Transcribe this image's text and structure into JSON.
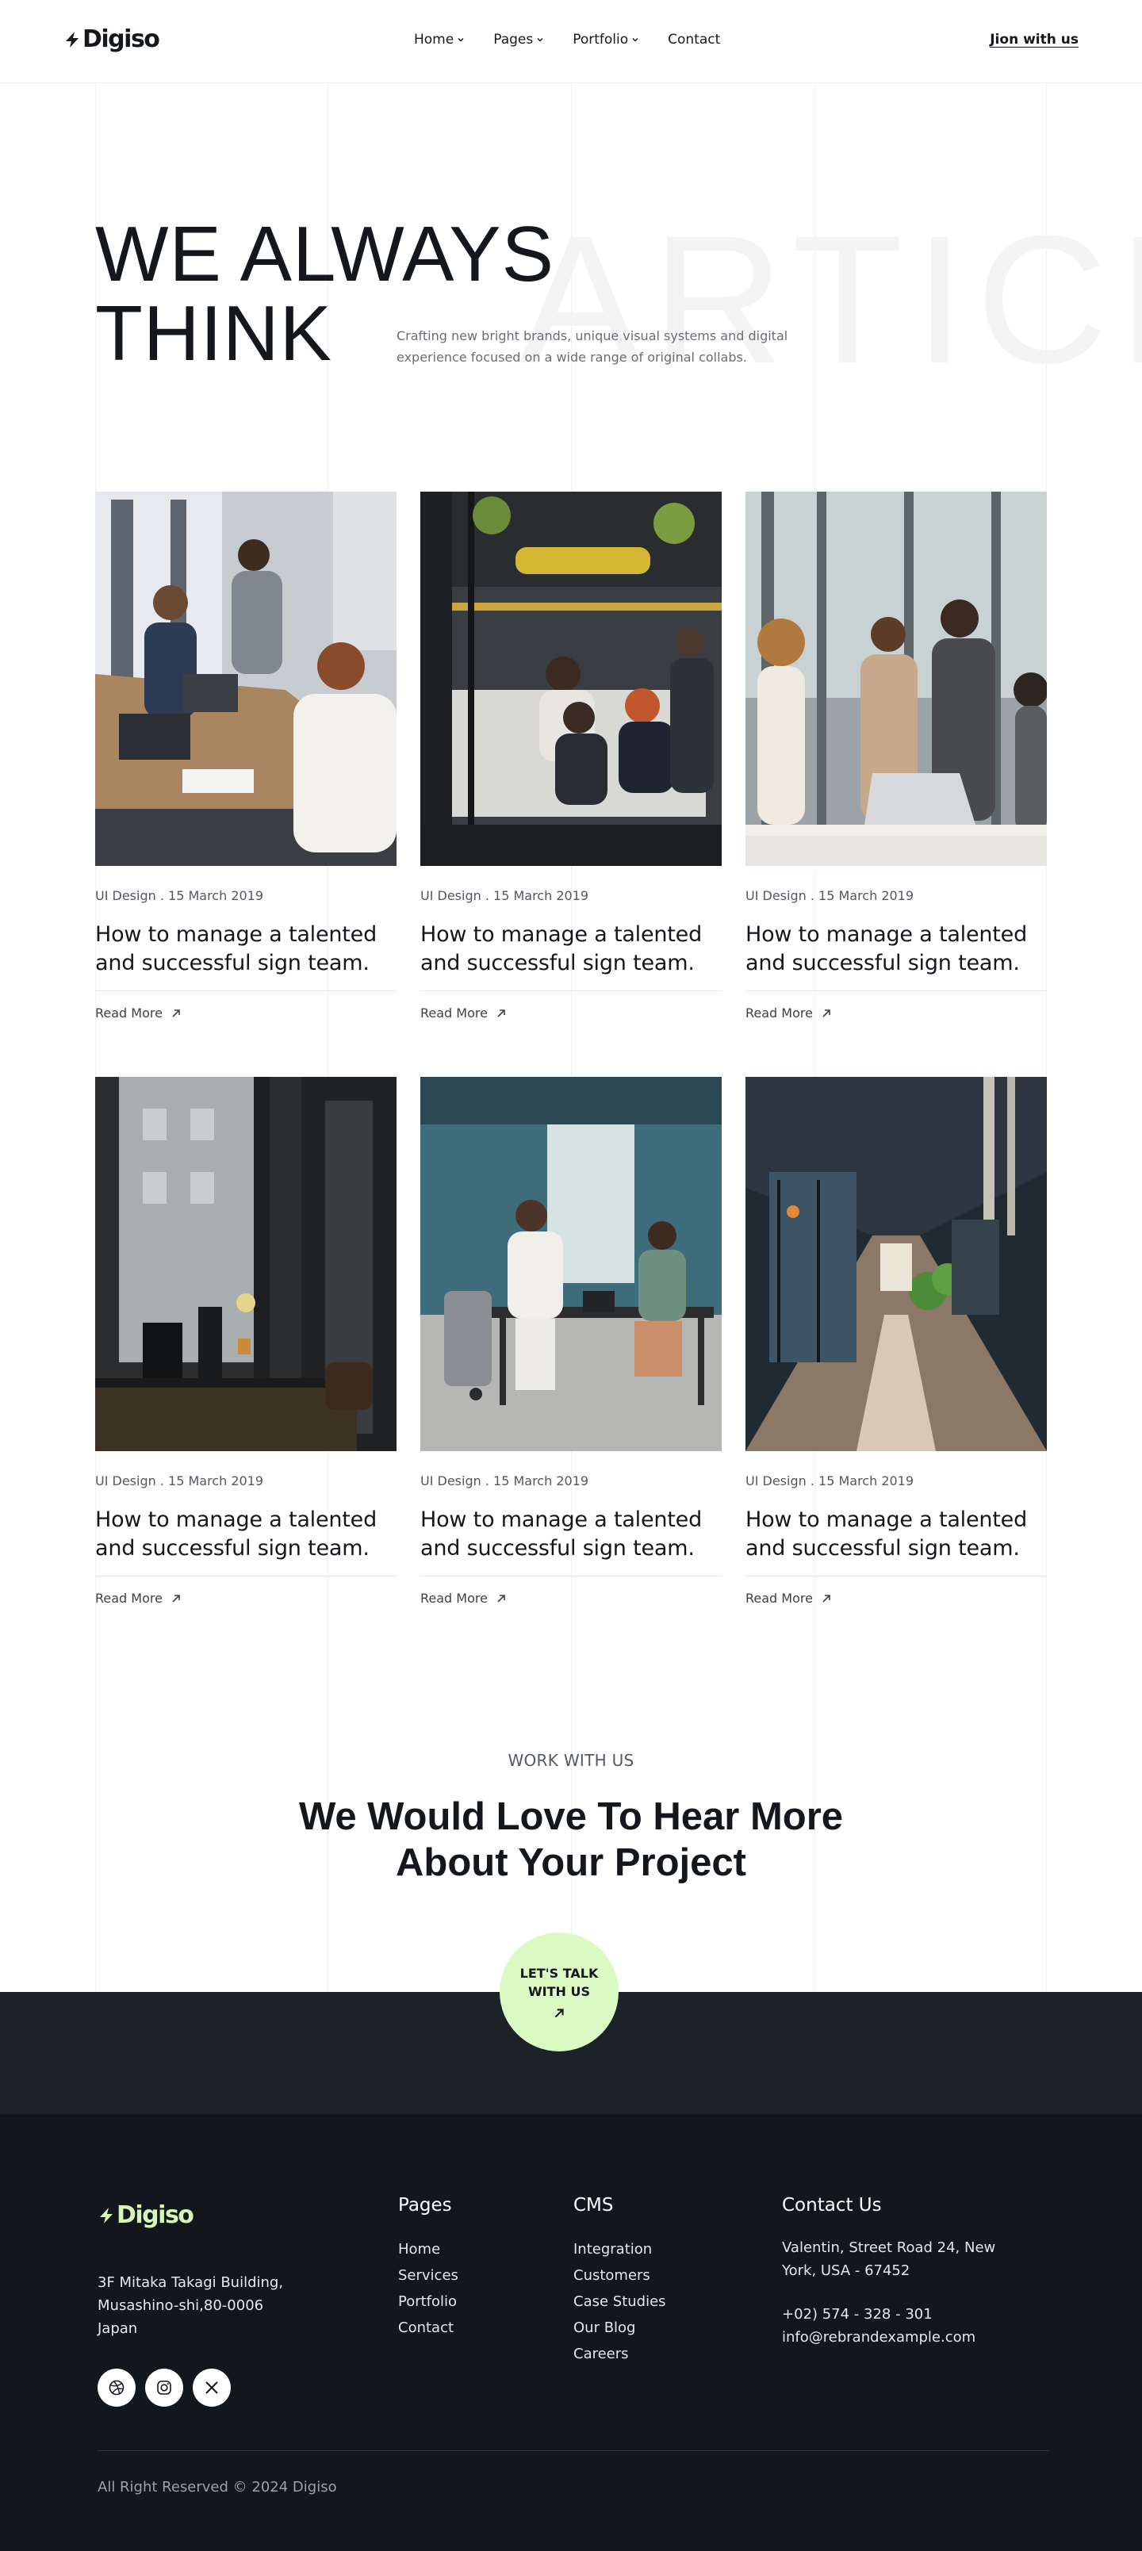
{
  "brand": {
    "name": "Digiso",
    "accent": "#dbf9c3",
    "dark": "#12171d"
  },
  "header": {
    "nav": [
      {
        "label": "Home",
        "has_dropdown": true
      },
      {
        "label": "Pages",
        "has_dropdown": true
      },
      {
        "label": "Portfolio",
        "has_dropdown": true
      },
      {
        "label": "Contact",
        "has_dropdown": false
      }
    ],
    "join_label": "Jion with us"
  },
  "hero": {
    "title_line1": "WE ALWAYS",
    "title_line2": "THINK",
    "background_word": "ARTICLE",
    "description": "Crafting new bright brands, unique visual systems and digital experience focused on a wide range of original collabs."
  },
  "articles": [
    {
      "meta": "UI Design . 15 March 2019",
      "title": "How to manage a talented and successful sign team.",
      "link": "Read More"
    },
    {
      "meta": "UI Design . 15 March 2019",
      "title": "How to manage a talented and successful sign team.",
      "link": "Read More"
    },
    {
      "meta": "UI Design . 15 March 2019",
      "title": "How to manage a talented and successful sign team.",
      "link": "Read More"
    },
    {
      "meta": "UI Design . 15 March 2019",
      "title": "How to manage a talented and successful sign team.",
      "link": "Read More"
    },
    {
      "meta": "UI Design . 15 March 2019",
      "title": "How to manage a talented and successful sign team.",
      "link": "Read More"
    },
    {
      "meta": "UI Design . 15 March 2019",
      "title": "How to manage a talented and successful sign team.",
      "link": "Read More"
    }
  ],
  "cta": {
    "label": "WORK WITH US",
    "title_line1": "We Would Love To Hear More",
    "title_line2": "About Your Project",
    "button": "LET'S TALK WITH US"
  },
  "footer": {
    "address": [
      "3F Mitaka Takagi Building,",
      "Musashino-shi,80-0006",
      "Japan"
    ],
    "socials": [
      "dribbble-icon",
      "instagram-icon",
      "x-icon"
    ],
    "pages": {
      "title": "Pages",
      "links": [
        "Home",
        "Services",
        "Portfolio",
        "Contact"
      ]
    },
    "cms": {
      "title": "CMS",
      "links": [
        "Integration",
        "Customers",
        "Case Studies",
        "Our Blog",
        "Careers"
      ]
    },
    "contact": {
      "title": "Contact Us",
      "address_line1": "Valentin, Street Road 24, New",
      "address_line2": "York, USA - 67452",
      "phone": "+02) 574 - 328 - 301",
      "email": "info@rebrandexample.com"
    },
    "copyright": "All Right Reserved © 2024 Digiso"
  }
}
